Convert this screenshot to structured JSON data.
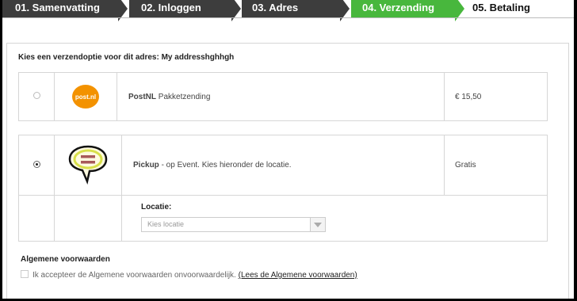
{
  "steps": [
    {
      "label": "01. Samenvatting",
      "state": "done"
    },
    {
      "label": "02. Inloggen",
      "state": "done"
    },
    {
      "label": "03. Adres",
      "state": "done"
    },
    {
      "label": "04. Verzending",
      "state": "active"
    },
    {
      "label": "05. Betaling",
      "state": "todo"
    }
  ],
  "colors": {
    "active": "#48b73d",
    "dark": "#3d3d3d",
    "postnl": "#f39200"
  },
  "shipping": {
    "heading": "Kies een verzendoptie voor dit adres: My addresshghhgh",
    "options": [
      {
        "selected": false,
        "logo_text": "post.nl",
        "logo_icon": "postnl-logo",
        "name": "PostNL",
        "description": "Pakketzending",
        "price": "€ 15,50"
      },
      {
        "selected": true,
        "logo_icon": "speech-bubble-logo",
        "name": "Pickup",
        "description": "- op Event. Kies hieronder de locatie.",
        "price": "Gratis",
        "location_label": "Locatie:",
        "location_placeholder": "Kies locatie"
      }
    ]
  },
  "terms": {
    "title": "Algemene voorwaarden",
    "checkbox_label": "Ik accepteer de Algemene voorwaarden onvoorwaardelijk.",
    "link_text": "(Lees de Algemene voorwaarden)",
    "checked": false
  }
}
